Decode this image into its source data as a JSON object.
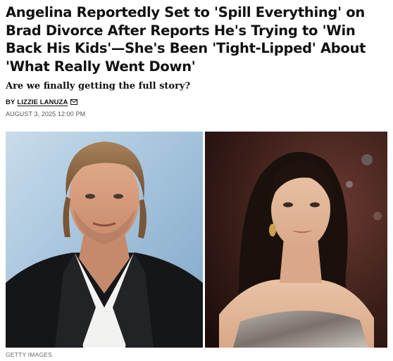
{
  "article": {
    "headline": "Angelina Reportedly Set to 'Spill Everything' on Brad Divorce After Reports He's Trying to 'Win Back His Kids'—She's Been 'Tight-Lipped' About 'What Really Went Down'",
    "dek": "Are we finally getting the full story?",
    "byline_prefix": "BY",
    "author": "LIZZIE LANUZA",
    "date": "AUGUST 3, 2025 12:00 PM",
    "photo_credit": "GETTY IMAGES"
  },
  "icons": {
    "author_contact": "mail-icon"
  },
  "colors": {
    "text": "#111111",
    "meta": "#555555",
    "credit": "#666666",
    "left_photo_bg": "#8fb3cf",
    "right_photo_bg": "#3a1d18"
  }
}
